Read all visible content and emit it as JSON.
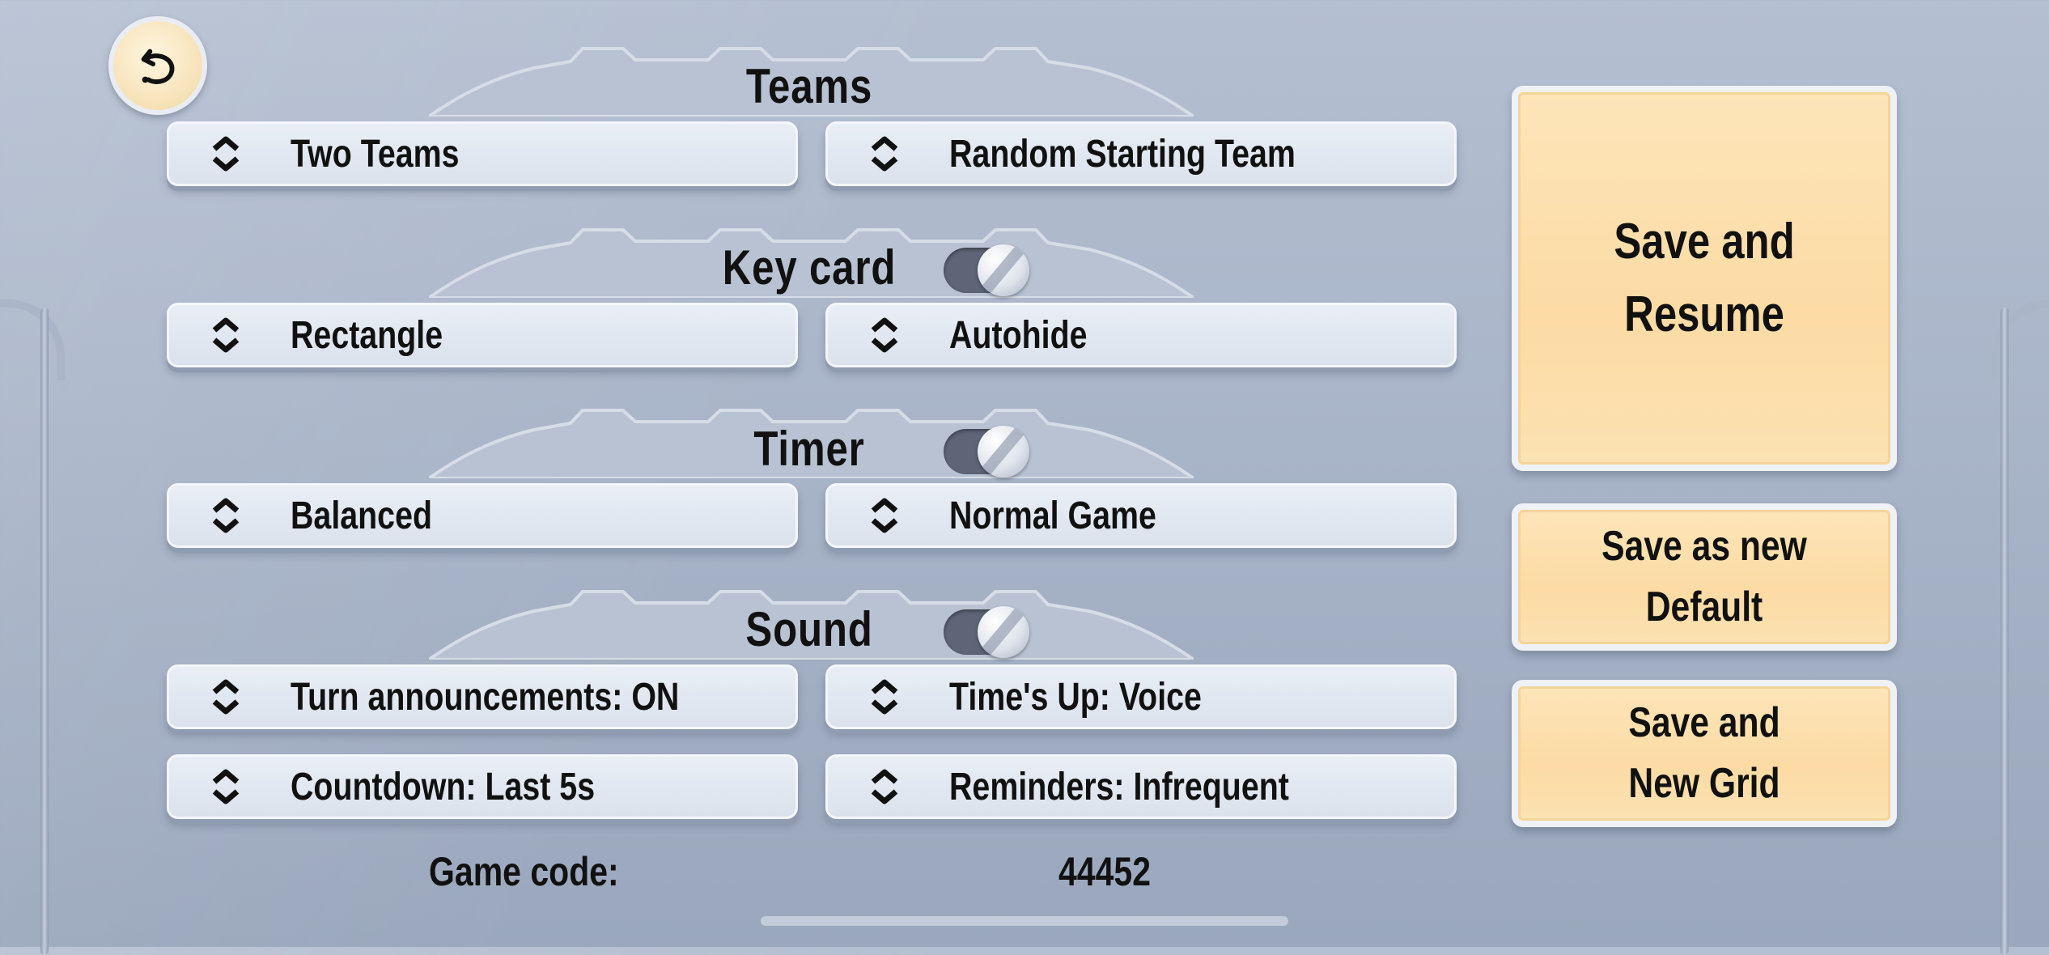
{
  "sections": {
    "teams": {
      "title": "Teams",
      "left_option": "Two Teams",
      "right_option": "Random Starting Team"
    },
    "key_card": {
      "title": "Key card",
      "enabled": true,
      "left_option": "Rectangle",
      "right_option": "Autohide"
    },
    "timer": {
      "title": "Timer",
      "enabled": true,
      "left_option": "Balanced",
      "right_option": "Normal Game"
    },
    "sound": {
      "title": "Sound",
      "enabled": true,
      "left_option": "Turn announcements: ON",
      "right_option": "Time's Up: Voice",
      "left_option_2": "Countdown: Last 5s",
      "right_option_2": "Reminders: Infrequent"
    }
  },
  "footer": {
    "game_code_label": "Game code:",
    "game_code_value": "44452"
  },
  "actions": {
    "save_resume": "Save and Resume",
    "save_default": "Save as new Default",
    "save_new_grid": "Save and New Grid"
  },
  "icons": {
    "back": "undo-arrow-icon",
    "option_selector": "chevron-up-down-icon"
  },
  "colors": {
    "background": "#a6b2c6",
    "option_fill": "#e3e9f2",
    "action_fill": "#fcdba4",
    "toggle_track": "#5d6576",
    "text": "#111111"
  }
}
